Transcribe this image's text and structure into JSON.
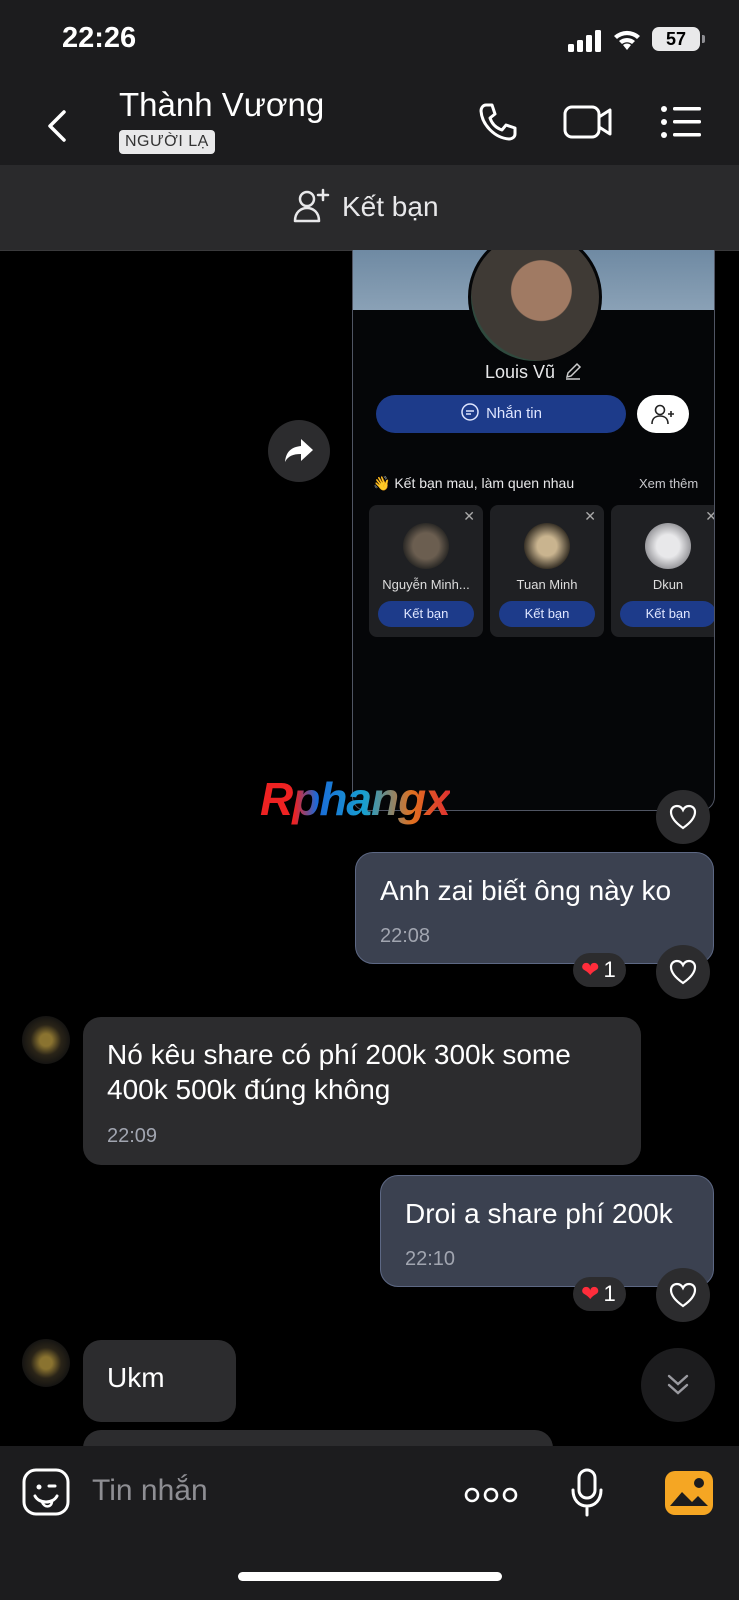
{
  "status_bar": {
    "time": "22:26",
    "battery": "57"
  },
  "header": {
    "contact_name": "Thành Vương",
    "badge": "NGƯỜI LẠ"
  },
  "add_friend_bar": {
    "label": "Kết bạn"
  },
  "shared_card": {
    "profile_name": "Louis Vũ",
    "message_button": "Nhắn tin",
    "suggest_title": "👋 Kết bạn mau, làm quen nhau",
    "see_more": "Xem thêm",
    "suggestions": [
      {
        "name": "Nguyễn Minh...",
        "button": "Kết bạn"
      },
      {
        "name": "Tuan Minh",
        "button": "Kết bạn"
      },
      {
        "name": "Dkun",
        "button": "Kết bạn"
      }
    ]
  },
  "watermark": "Rphangx",
  "messages": [
    {
      "direction": "outgoing",
      "text": "Anh zai biết ông này ko",
      "time": "22:08",
      "reaction": "1"
    },
    {
      "direction": "incoming",
      "text": "Nó kêu share có phí 200k 300k some 400k 500k đúng không",
      "time": "22:09"
    },
    {
      "direction": "outgoing",
      "text": "Droi a share phí 200k",
      "time": "22:10",
      "reaction": "1"
    },
    {
      "direction": "incoming",
      "text": "Ukm"
    }
  ],
  "composer": {
    "placeholder": "Tin nhắn"
  },
  "colors": {
    "outgoing_bubble": "#3b4150",
    "incoming_bubble": "#2c2c2e",
    "accent_blue": "#1d3b8a",
    "image_icon": "#f5a623"
  },
  "icons": [
    "back-icon",
    "phone-icon",
    "video-camera-icon",
    "list-menu-icon",
    "add-friend-icon",
    "forward-icon",
    "heart-icon",
    "sticker-icon",
    "more-dots-icon",
    "microphone-icon",
    "image-icon",
    "chevron-down-icon"
  ]
}
